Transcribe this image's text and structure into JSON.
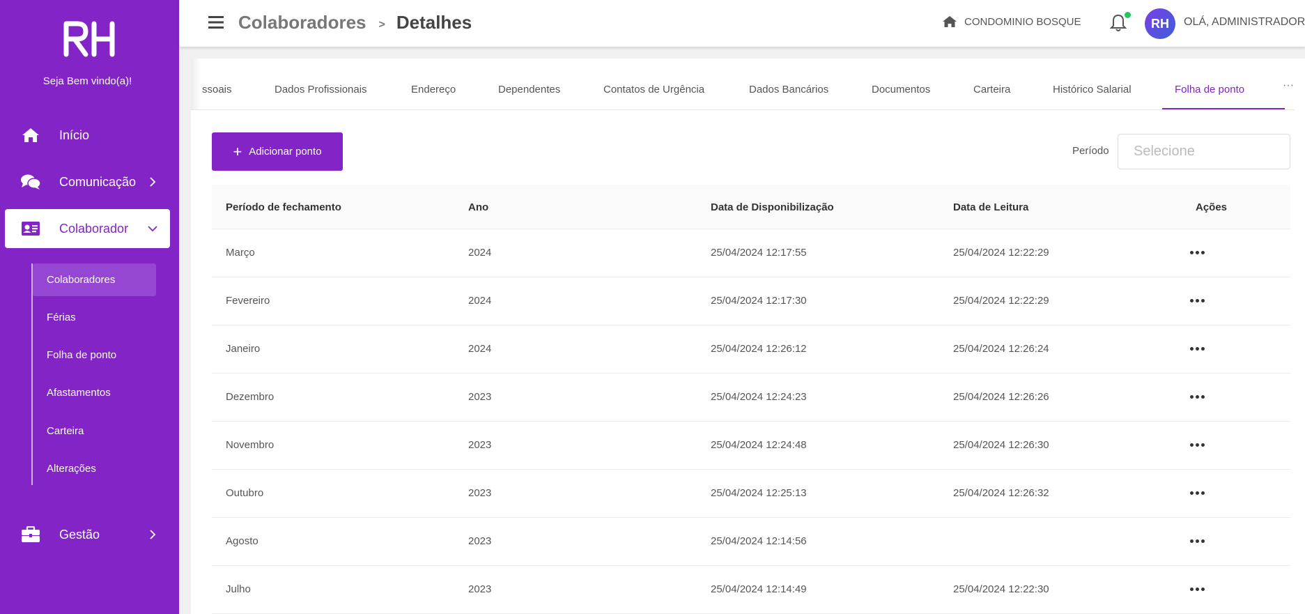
{
  "sidebar": {
    "logo_text": "RH",
    "welcome": "Seja Bem vindo(a)!",
    "items": [
      {
        "label": "Início",
        "icon": "home-icon"
      },
      {
        "label": "Comunicação",
        "icon": "chat-icon"
      },
      {
        "label": "Colaborador",
        "icon": "id-card-icon"
      },
      {
        "label": "Gestão",
        "icon": "briefcase-icon"
      }
    ],
    "submenu": [
      {
        "label": "Colaboradores"
      },
      {
        "label": "Férias"
      },
      {
        "label": "Folha de ponto"
      },
      {
        "label": "Afastamentos"
      },
      {
        "label": "Carteira"
      },
      {
        "label": "Alterações"
      }
    ],
    "accent": "#8224c6"
  },
  "header": {
    "breadcrumb_1": "Colaboradores",
    "breadcrumb_sep": ">",
    "breadcrumb_2": "Detalhes",
    "condo": "CONDOMINIO BOSQUE",
    "avatar_text": "RH",
    "greeting": "OLÁ, ADMINISTRADOR",
    "notification_dot_color": "#22c55e"
  },
  "tabs": [
    {
      "label": "ssoais"
    },
    {
      "label": "Dados Profissionais"
    },
    {
      "label": "Endereço"
    },
    {
      "label": "Dependentes"
    },
    {
      "label": "Contatos de Urgência"
    },
    {
      "label": "Dados Bancários"
    },
    {
      "label": "Documentos"
    },
    {
      "label": "Carteira"
    },
    {
      "label": "Histórico Salarial"
    },
    {
      "label": "Folha de ponto",
      "active": true
    }
  ],
  "tabs_more": "···",
  "toolbar": {
    "add_label": "Adicionar ponto",
    "period_label": "Período",
    "period_placeholder": "Selecione"
  },
  "table": {
    "headers": [
      "Período de fechamento",
      "Ano",
      "Data de Disponibilização",
      "Data de Leitura",
      "Ações"
    ],
    "rows": [
      {
        "periodo": "Março",
        "ano": "2024",
        "disp": "25/04/2024 12:17:55",
        "leitura": "25/04/2024 12:22:29"
      },
      {
        "periodo": "Fevereiro",
        "ano": "2024",
        "disp": "25/04/2024 12:17:30",
        "leitura": "25/04/2024 12:22:29"
      },
      {
        "periodo": "Janeiro",
        "ano": "2024",
        "disp": "25/04/2024 12:26:12",
        "leitura": "25/04/2024 12:26:24"
      },
      {
        "periodo": "Dezembro",
        "ano": "2023",
        "disp": "25/04/2024 12:24:23",
        "leitura": "25/04/2024 12:26:26"
      },
      {
        "periodo": "Novembro",
        "ano": "2023",
        "disp": "25/04/2024 12:24:48",
        "leitura": "25/04/2024 12:26:30"
      },
      {
        "periodo": "Outubro",
        "ano": "2023",
        "disp": "25/04/2024 12:25:13",
        "leitura": "25/04/2024 12:26:32"
      },
      {
        "periodo": "Agosto",
        "ano": "2023",
        "disp": "25/04/2024 12:14:56",
        "leitura": ""
      },
      {
        "periodo": "Julho",
        "ano": "2023",
        "disp": "25/04/2024 12:14:49",
        "leitura": "25/04/2024 12:22:30"
      }
    ]
  }
}
